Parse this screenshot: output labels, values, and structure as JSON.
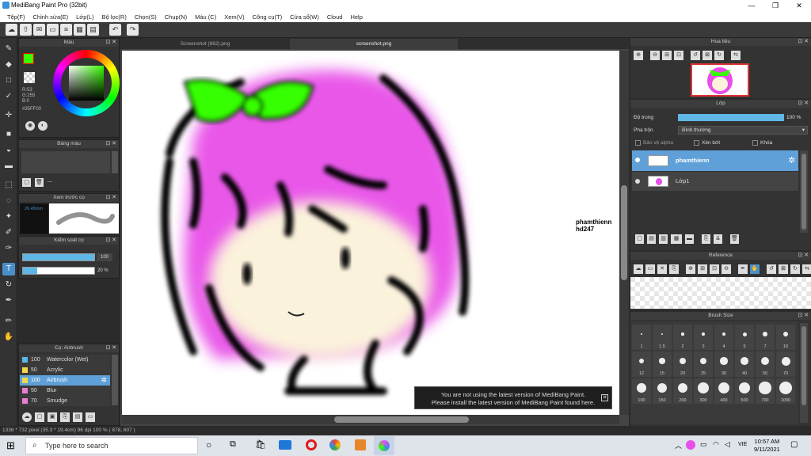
{
  "window": {
    "title": "MediBang Paint Pro (32bit)",
    "minimize": "—",
    "maximize": "❐",
    "close": "✕"
  },
  "menu": [
    "Tệp(F)",
    "Chỉnh sửa(E)",
    "Lớp(L)",
    "Bộ lọc(R)",
    "Chọn(S)",
    "Chụp(N)",
    "Màu (C)",
    "Xem(V)",
    "Công cụ(T)",
    "Cửa sổ(W)",
    "Cloud",
    "Help"
  ],
  "tabs": {
    "tab1": "Screenshot (862).png",
    "tab2": "screenshot.png"
  },
  "color_panel": {
    "title": "Màu",
    "r": "R:53",
    "g": "G:255",
    "b": "B:0",
    "hex": "#35FF00",
    "fg": "#35FF00",
    "bg": "#000000"
  },
  "palette_panel": {
    "title": "Bảng màu",
    "name": "---"
  },
  "preview_panel": {
    "title": "Xem trước cọ",
    "size": "26.45mm"
  },
  "brush_control": {
    "title": "Kiểm soát cọ",
    "size_value": "100",
    "opacity_value": "20 %",
    "size_pct": 1.0,
    "opacity_pct": 0.2
  },
  "brush_list": {
    "title": "Cọ: Airbrush",
    "items": [
      {
        "size": "100",
        "name": "Watercolor (Wet)",
        "color": "#5fb7e5"
      },
      {
        "size": "50",
        "name": "Acrylic",
        "color": "#f0d84a"
      },
      {
        "size": "100",
        "name": "Airbrush",
        "color": "#f0d84a"
      },
      {
        "size": "50",
        "name": "Blur",
        "color": "#e87fd2"
      },
      {
        "size": "70",
        "name": "Smudge",
        "color": "#e87fd2"
      }
    ]
  },
  "navigator": {
    "title": "Hoa tiêu"
  },
  "layer_panel": {
    "title": "Lớp",
    "opacity_label": "Độ trong",
    "opacity_value": "100 %",
    "opacity_pct": 1.0,
    "blend_label": "Pha trộn",
    "blend_value": "Bình thường",
    "protect_alpha": "Bảo vệ alpha",
    "clipping": "Xén bớt",
    "lock": "Khóa",
    "layers": [
      {
        "name": "phamthienn",
        "selected": true
      },
      {
        "name": "Lớp1",
        "selected": false
      }
    ]
  },
  "reference_panel": {
    "title": "Reference"
  },
  "brush_size_panel": {
    "title": "Brush Size",
    "sizes": [
      "1",
      "1.5",
      "2",
      "3",
      "4",
      "5",
      "7",
      "10",
      "12",
      "15",
      "20",
      "25",
      "30",
      "40",
      "50",
      "70",
      "100",
      "150",
      "200",
      "300",
      "400",
      "500",
      "700",
      "1000"
    ]
  },
  "canvas_text": [
    "phamthienn",
    "hd247"
  ],
  "notification": {
    "line1": "You are not using the latest version of MediBang Paint.",
    "line2": "Please install the latest version of MediBang Paint found here."
  },
  "status": "1336 * 732 pixel   (35.3 * 19.4cm)  96 dpi  100 %  ( 878, 607 )",
  "taskbar": {
    "search": "Type here to search",
    "time": "10:57 AM",
    "date": "9/11/2021",
    "lang": "VIE"
  }
}
